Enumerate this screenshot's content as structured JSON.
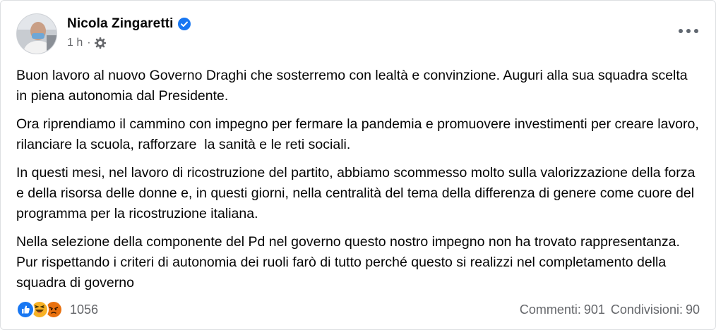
{
  "post": {
    "author": "Nicola Zingaretti",
    "time": "1 h",
    "separator": "·",
    "paragraphs": [
      "Buon lavoro al nuovo Governo Draghi che sosterremo con lealtà e convinzione. Auguri alla sua squadra scelta in piena autonomia dal Presidente.",
      "Ora riprendiamo il cammino con impegno per fermare la pandemia e promuovere investimenti per creare lavoro, rilanciare la scuola, rafforzare  la sanità e le reti sociali.",
      "In questi mesi, nel lavoro di ricostruzione del partito, abbiamo scommesso molto sulla valorizzazione della forza e della risorsa delle donne e, in questi giorni, nella centralità del tema della differenza di genere come cuore del programma per la ricostruzione italiana.",
      "Nella selezione della componente del Pd nel governo questo nostro impegno non ha trovato rappresentanza. Pur rispettando i criteri di autonomia dei ruoli farò di tutto perché questo si realizzi nel completamento della squadra di governo"
    ],
    "reactions": {
      "count": "1056",
      "types": [
        "like-icon",
        "haha-icon",
        "angry-icon"
      ]
    },
    "comments_label": "Commenti:",
    "comments_count": "901",
    "shares_label": "Condivisioni:",
    "shares_count": "90"
  },
  "colors": {
    "text": "#050505",
    "secondary": "#65676b",
    "verified": "#1877f2",
    "like": "#1877f2",
    "haha": "#f7b125",
    "angry": "#e9710f"
  }
}
